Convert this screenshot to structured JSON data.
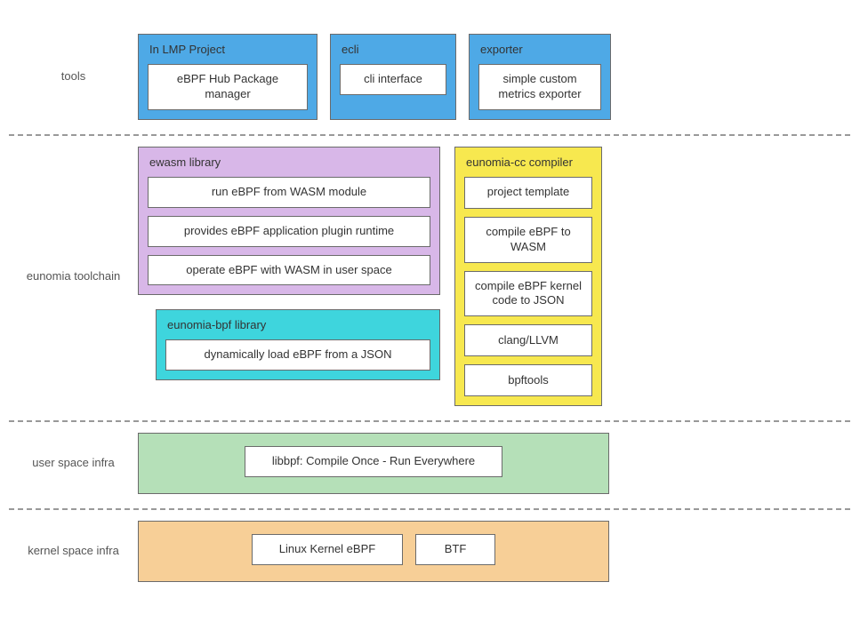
{
  "rows": {
    "tools": "tools",
    "toolchain": "eunomia toolchain",
    "user": "user space infra",
    "kernel": "kernel space infra"
  },
  "tools": {
    "lmp": {
      "title": "In LMP Project",
      "item": "eBPF Hub Package manager"
    },
    "ecli": {
      "title": "ecli",
      "item": "cli interface"
    },
    "exporter": {
      "title": "exporter",
      "item": "simple custom metrics exporter"
    }
  },
  "toolchain": {
    "ewasm": {
      "title": "ewasm library",
      "items": [
        "run eBPF from WASM module",
        "provides eBPF application plugin runtime",
        "operate eBPF with WASM in user space"
      ]
    },
    "ebpf_lib": {
      "title": "eunomia-bpf library",
      "item": "dynamically load eBPF from a JSON"
    },
    "cc": {
      "title": "eunomia-cc compiler",
      "items": [
        "project template",
        "compile eBPF to WASM",
        "compile eBPF kernel code to JSON",
        "clang/LLVM",
        "bpftools"
      ]
    }
  },
  "user_space": {
    "item": "libbpf: Compile Once - Run Everywhere"
  },
  "kernel_space": {
    "items": [
      "Linux Kernel eBPF",
      "BTF"
    ]
  },
  "colors": {
    "blue": "#4ea9e6",
    "purple": "#d8b7e8",
    "cyan": "#3ed5dd",
    "yellow": "#f7e84f",
    "green": "#b5e0b8",
    "orange": "#f7cf97"
  }
}
